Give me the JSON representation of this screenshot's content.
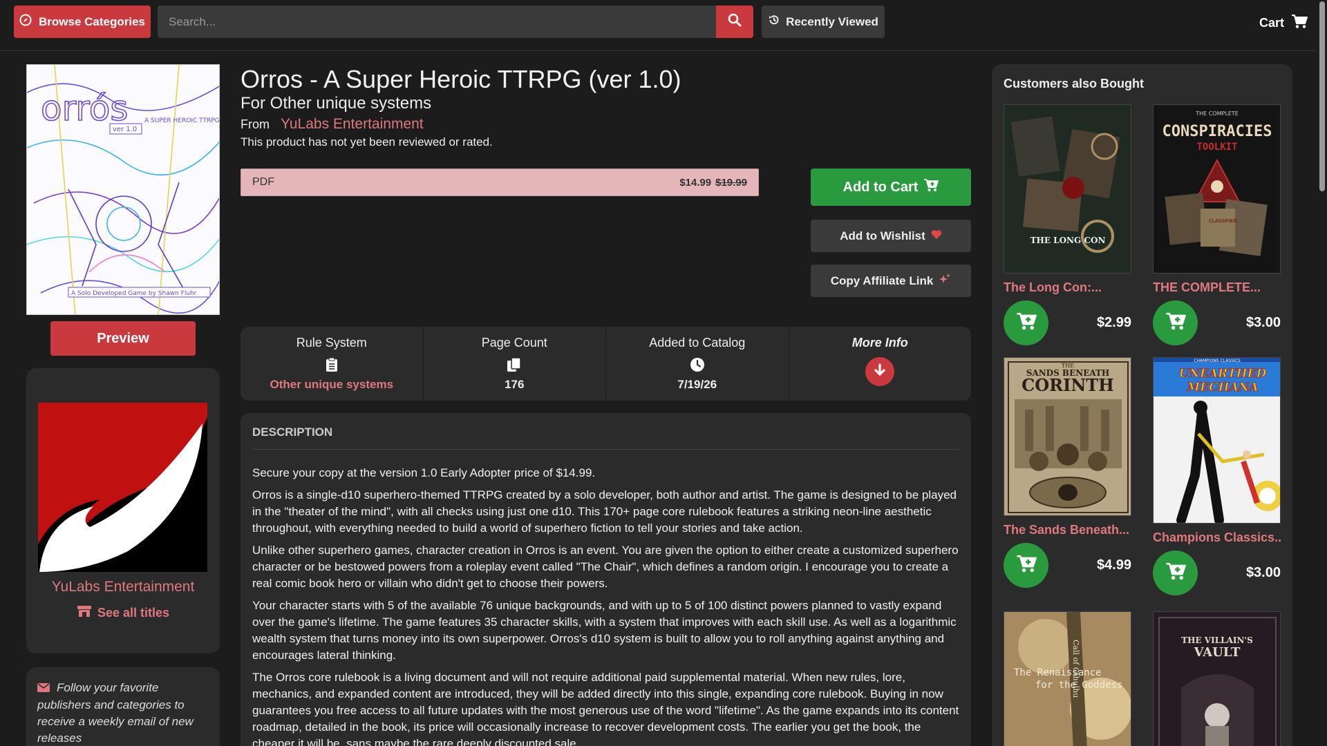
{
  "header": {
    "browse_label": "Browse Categories",
    "search_placeholder": "Search...",
    "recent_label": "Recently Viewed",
    "cart_label": "Cart"
  },
  "product": {
    "title": "Orros - A Super Heroic TTRPG (ver 1.0)",
    "subtitle": "For Other unique systems",
    "from_label": "From",
    "publisher": "YuLabs Entertainment",
    "rating_text": "This product has not yet been reviewed or rated.",
    "format": "PDF",
    "price": "$14.99",
    "old_price": "$19.99",
    "preview_label": "Preview",
    "cover_title": "orrós",
    "cover_ver": "ver 1.0",
    "cover_tag": "A SUPER HEROIC TTRPG",
    "cover_credit": "A Solo Developed Game by Shawn Fluhr"
  },
  "actions": {
    "add_to_cart": "Add to Cart",
    "add_to_wishlist": "Add to Wishlist",
    "copy_affiliate": "Copy Affiliate Link"
  },
  "info": {
    "rule_system_label": "Rule System",
    "rule_system_value": "Other unique systems",
    "page_count_label": "Page Count",
    "page_count_value": "176",
    "added_label": "Added to Catalog",
    "added_value": "7/19/26",
    "more_info_label": "More Info"
  },
  "description": {
    "heading": "DESCRIPTION",
    "paragraphs": [
      "Secure your copy at the version 1.0 Early Adopter price of $14.99.",
      "Orros is a single-d10 superhero-themed TTRPG created by a solo developer, both author and artist. The game is designed to be played in the \"theater of the mind\", with all checks using just one d10. This 170+ page core rulebook features a striking neon-line aesthetic throughout, with everything needed to build a world of superhero fiction to tell your stories and take action.",
      "Unlike other superhero games, character creation in Orros is an event. You are given the option to either create a customized superhero character or be bestowed powers from a roleplay event called \"The Chair\", which defines a random origin. I encourage you to create a real comic book hero or villain who didn't get to choose their powers.",
      "Your character starts with 5 of the available 76 unique backgrounds, and with up to 5 of 100 distinct powers planned to vastly expand over the game's lifetime. The game features 35 character skills, with a system that improves with each skill use. As well as a logarithmic wealth system that turns money into its own superpower. Orros's d10 system is built to allow you to roll anything against anything and encourages lateral thinking.",
      "The Orros core rulebook is a living document and will not require additional paid supplemental material. When new rules, lore, mechanics, and expanded content are introduced, they will be added directly into this single, expanding core rulebook. Buying in now guarantees you free access to all future updates with the most generous use of the word \"lifetime\". As the game expands into its content roadmap, detailed in the book, its price will occasionally increase to recover development costs. The earlier you get the book, the cheaper it will be, sans maybe the rare deeply discounted sale."
    ]
  },
  "publisher_card": {
    "name": "YuLabs Entertainment",
    "see_all": "See all titles"
  },
  "follow": {
    "text": "Follow your favorite publishers and categories to receive a weekly email of new releases"
  },
  "also_bought": {
    "title": "Customers also Bought",
    "items": [
      {
        "name": "The Long Con:...",
        "price": "$2.99",
        "cover_text": "THE LONG CON"
      },
      {
        "name": "THE COMPLETE...",
        "price": "$3.00",
        "cover_pre": "THE COMPLETE",
        "cover_text": "CONSPIRACIES",
        "cover_sub": "TOOLKIT",
        "cover_stamp": "CLASSIFIED"
      },
      {
        "name": "The Sands Beneath...",
        "price": "$4.99",
        "cover_pre": "THE",
        "cover_text": "SANDS BENEATH",
        "cover_sub": "CORINTH"
      },
      {
        "name": "Champions Classics...",
        "price": "$3.00",
        "cover_pre": "CHAMPIONS CLASSICS",
        "cover_text": "UNEARTHED",
        "cover_sub": "MECHANA"
      },
      {
        "cover_text": "The Renaissance",
        "cover_sub": "for the Goddess",
        "cover_spine": "Call of Cthulhu"
      },
      {
        "cover_text": "THE VILLAIN'S",
        "cover_sub": "VAULT"
      }
    ]
  },
  "colors": {
    "accent": "#c9393e",
    "link": "#e0797c",
    "buy": "#2a9a3e",
    "panel": "#2b2b2b",
    "background": "#1c1c1c"
  }
}
